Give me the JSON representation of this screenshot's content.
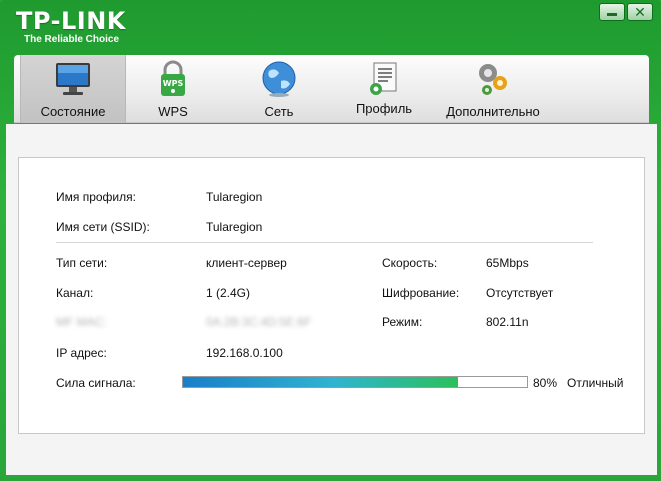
{
  "header": {
    "brand": "TP-LINK",
    "tagline": "The Reliable Choice",
    "minimize_icon": "minimize-icon",
    "close_icon": "close-icon",
    "close_glyph": "✕"
  },
  "tabs": [
    {
      "label": "Состояние",
      "icon": "monitor-icon",
      "active": true
    },
    {
      "label": "WPS",
      "icon": "wps-lock-icon",
      "active": false
    },
    {
      "label": "Сеть",
      "icon": "globe-icon",
      "active": false
    },
    {
      "label": "Профиль",
      "icon": "document-icon",
      "active": false
    },
    {
      "label": "Дополнительно",
      "icon": "gears-icon",
      "active": false
    }
  ],
  "status": {
    "profile_name_label": "Имя профиля:",
    "profile_name_value": "Tularegion",
    "ssid_label": "Имя сети (SSID):",
    "ssid_value": "Tularegion",
    "network_type_label": "Тип сети:",
    "network_type_value": "клиент-сервер",
    "channel_label": "Канал:",
    "channel_value": "1 (2.4G)",
    "mac_label_blurred": "MF MAC:",
    "mac_value_blurred": "0A:2B:3C:4D:5E:6F",
    "ip_label": "IP адрес:",
    "ip_value": "192.168.0.100",
    "speed_label": "Скорость:",
    "speed_value": "65Mbps",
    "encryption_label": "Шифрование:",
    "encryption_value": "Отсутствует",
    "mode_label": "Режим:",
    "mode_value": "802.11n",
    "signal_label": "Сила сигнала:",
    "signal_percent": 80,
    "signal_percent_text": "80%",
    "signal_quality": "Отличный"
  },
  "colors": {
    "brand_green": "#2aa53a",
    "signal_start": "#1a7ec9",
    "signal_end": "#2cc05a"
  }
}
